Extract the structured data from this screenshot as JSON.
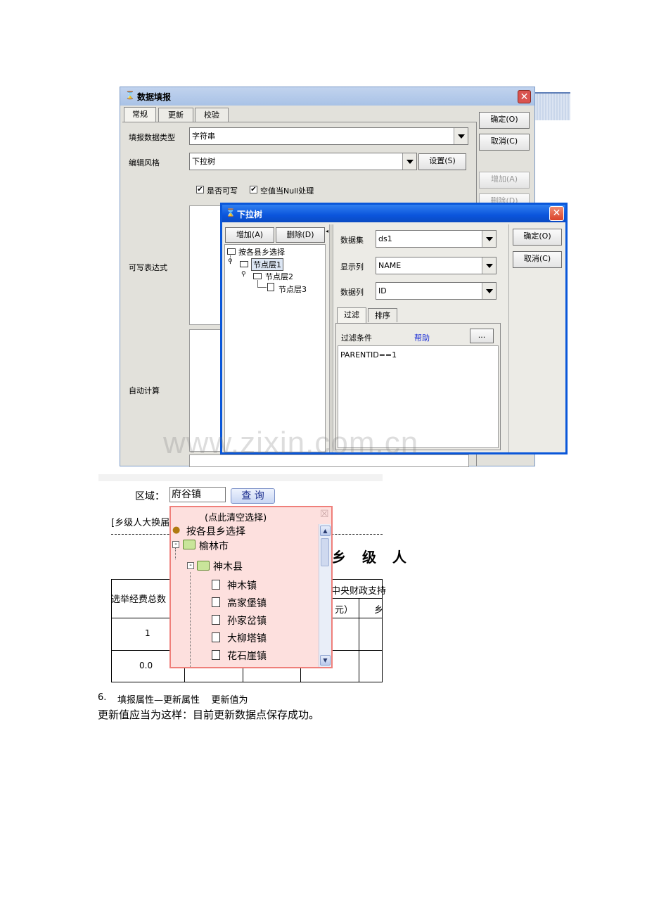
{
  "dialog_main": {
    "title": "数据填报",
    "tabs": [
      "常规",
      "更新",
      "校验"
    ],
    "ok_label": "确定(O)",
    "cancel_label": "取消(C)",
    "add_label": "增加(A)",
    "delete_label": "删除(D)",
    "fields": {
      "type_label": "填报数据类型",
      "type_value": "字符串",
      "style_label": "编辑风格",
      "style_value": "下拉树",
      "settings_label": "设置(S)",
      "writable_label": "是否可写",
      "null_label": "空值当Null处理",
      "writable_expr_label": "可写表达式",
      "auto_calc_label": "自动计算"
    }
  },
  "dialog_tree": {
    "title": "下拉树",
    "add_label": "增加(A)",
    "delete_label": "删除(D)",
    "ok_label": "确定(O)",
    "cancel_label": "取消(C)",
    "tree": {
      "root": "按各县乡选择",
      "level1": "节点层1",
      "level2": "节点层2",
      "level3": "节点层3"
    },
    "dataset_label": "数据集",
    "dataset_value": "ds1",
    "display_label": "显示列",
    "display_value": "NAME",
    "data_label": "数据列",
    "data_value": "ID",
    "tabs": [
      "过滤",
      "排序"
    ],
    "filter_label": "过滤条件",
    "help_label": "帮助",
    "more_label": "...",
    "filter_text": "PARENTID==1"
  },
  "watermark": "www.zixin.com.cn",
  "web_widget": {
    "region_label": "区域：",
    "region_value": "府谷镇",
    "query_label": "查 询",
    "report_header": "[乡级人大换届",
    "report_title": "乡 级 人",
    "popup": {
      "clear_label": "(点此清空选择)",
      "root": "按各县乡选择",
      "city": "榆林市",
      "county": "神木县",
      "towns": [
        "神木镇",
        "高家堡镇",
        "孙家岔镇",
        "大柳塔镇",
        "花石崖镇"
      ]
    },
    "table": {
      "col1_header": "选举经费总数",
      "col_center_header": "中央财政支持",
      "unit_fragment": "元）",
      "fragment2": "乡",
      "row1": "1",
      "row2": "0.0"
    }
  },
  "doc_text": {
    "item_number": "6.",
    "item_text": "填报属性—更新属性    更新值为",
    "paragraph": "更新值应当为这样：目前更新数据点保存成功。"
  }
}
